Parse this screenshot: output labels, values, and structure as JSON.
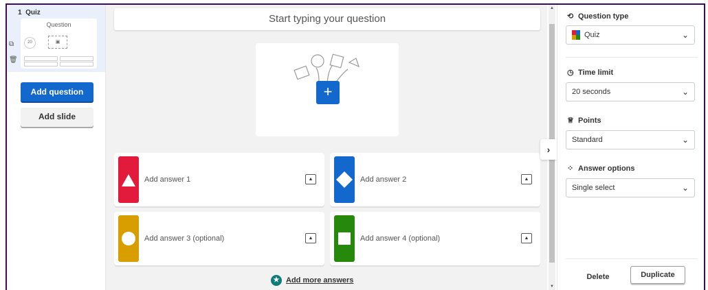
{
  "sidebar": {
    "slide_number": "1",
    "slide_type": "Quiz",
    "thumb_title": "Question",
    "thumb_timer": "20",
    "add_question_label": "Add question",
    "add_slide_label": "Add slide",
    "duplicate_icon": "duplicate-icon",
    "delete_icon": "trash-icon"
  },
  "editor": {
    "question_placeholder": "Start typing your question",
    "media_add_icon": "+",
    "answers": [
      {
        "label": "Add answer 1",
        "shape": "triangle",
        "color": "#e21b3c"
      },
      {
        "label": "Add answer 2",
        "shape": "diamond",
        "color": "#1368ce"
      },
      {
        "label": "Add answer 3 (optional)",
        "shape": "circle",
        "color": "#d89e00"
      },
      {
        "label": "Add answer 4 (optional)",
        "shape": "square",
        "color": "#26890c"
      }
    ],
    "add_more_answers": "Add more answers"
  },
  "settings": {
    "question_type_title": "Question type",
    "question_type_value": "Quiz",
    "time_limit_title": "Time limit",
    "time_limit_value": "20 seconds",
    "points_title": "Points",
    "points_value": "Standard",
    "answer_options_title": "Answer options",
    "answer_options_value": "Single select",
    "delete_label": "Delete",
    "duplicate_label": "Duplicate"
  },
  "colors": {
    "accent_blue": "#1368ce",
    "frame": "#3b0a5a"
  }
}
